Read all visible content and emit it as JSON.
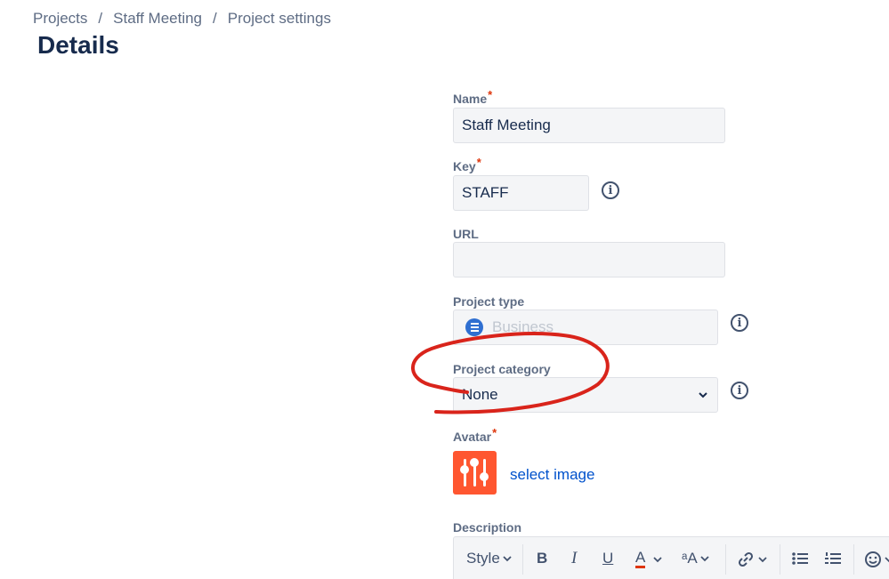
{
  "breadcrumb": {
    "items": [
      "Projects",
      "Staff Meeting",
      "Project settings"
    ],
    "separator": "/"
  },
  "page": {
    "title": "Details"
  },
  "form": {
    "name": {
      "label": "Name",
      "required_mark": "*",
      "value": "Staff Meeting"
    },
    "key": {
      "label": "Key",
      "required_mark": "*",
      "value": "STAFF"
    },
    "url": {
      "label": "URL",
      "value": ""
    },
    "project_type": {
      "label": "Project type",
      "value": "Business",
      "icon": "business-icon"
    },
    "project_category": {
      "label": "Project category",
      "value": "None",
      "options": [
        "None"
      ]
    },
    "avatar": {
      "label": "Avatar",
      "required_mark": "*",
      "link_text": "select image",
      "icon": "sliders-icon",
      "color": "#ff5630"
    },
    "description": {
      "label": "Description"
    }
  },
  "toolbar": {
    "style_label": "Style",
    "bold_label": "B",
    "italic_label": "I",
    "underline_label": "U",
    "text_color_label": "A",
    "more_formatting_label": "ᵃA",
    "text_color_underline": "#de350b"
  },
  "info_glyph": "i",
  "annotation": {
    "color": "#d9241b",
    "kind": "hand-drawn circle around Project category"
  }
}
